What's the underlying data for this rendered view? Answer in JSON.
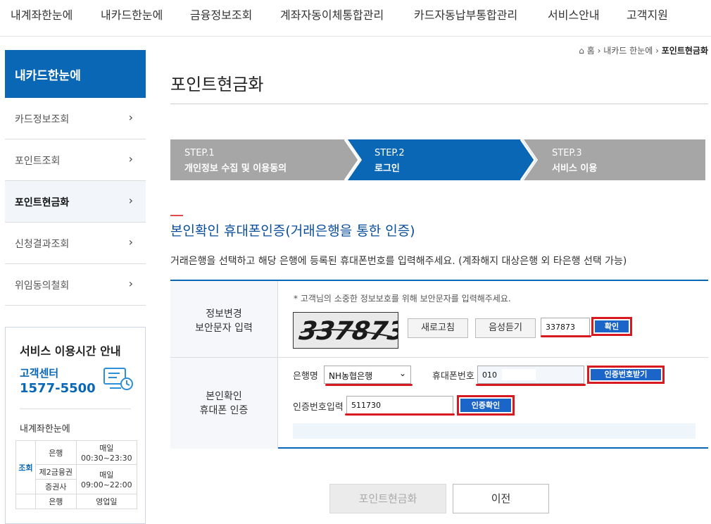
{
  "top_nav": [
    "내계좌한눈에",
    "내카드한눈에",
    "금융정보조회",
    "계좌자동이체통합관리",
    "카드자동납부통합관리",
    "서비스안내",
    "고객지원"
  ],
  "sidebar": {
    "title": "내카드한눈에",
    "items": [
      {
        "label": "카드정보조회"
      },
      {
        "label": "포인트조회"
      },
      {
        "label": "포인트현금화"
      },
      {
        "label": "신청결과조회"
      },
      {
        "label": "위임동의철회"
      }
    ],
    "active_index": 2
  },
  "service_box": {
    "title": "서비스 이용시간 안내",
    "center_label": "고객센터",
    "center_phone": "1577-5500",
    "subtitle": "내계좌한눈에",
    "table": {
      "category": "조회",
      "rows": [
        {
          "type": "은행",
          "time_label": "매일",
          "time": "00:30~23:30"
        },
        {
          "type": "제2금융권",
          "time_label": "매일",
          "time": "09:00~22:00"
        },
        {
          "type": "증권사",
          "time_label": "",
          "time": ""
        },
        {
          "type": "은행",
          "time_label": "영업일",
          "time": ""
        }
      ]
    }
  },
  "breadcrumb": {
    "home": "홈",
    "level1": "내카드 한눈에",
    "current": "포인트현금화"
  },
  "page_title": "포인트현금화",
  "steps": [
    {
      "num": "STEP.1",
      "label": "개인정보 수집 및 이용동의",
      "active": false
    },
    {
      "num": "STEP.2",
      "label": "로그인",
      "active": true
    },
    {
      "num": "STEP.3",
      "label": "서비스 이용",
      "active": false
    }
  ],
  "section": {
    "title": "본인확인 휴대폰인증(거래은행을 통한 인증)",
    "desc": "거래은행을 선택하고 해당 은행에 등록된 휴대폰번호를 입력해주세요. (계좌해지 대상은행 외 타은행 선택 가능)"
  },
  "captcha_row": {
    "label_l1": "정보변경",
    "label_l2": "보안문자 입력",
    "notice": "* 고객님의 소중한 정보보호를 위해 보안문자를 입력해주세요.",
    "captcha_text": "337873",
    "refresh_btn": "새로고침",
    "audio_btn": "음성듣기",
    "input_value": "337873",
    "confirm_btn": "확인"
  },
  "phone_row": {
    "label_l1": "본인확인",
    "label_l2": "휴대폰 인증",
    "bank_label": "은행명",
    "bank_value": "NH농협은행",
    "phone_label": "휴대폰번호",
    "phone_value": "010",
    "get_code_btn": "인증번호받기",
    "code_label": "인증번호입력",
    "code_value": "511730",
    "verify_btn": "인증확인"
  },
  "bottom_buttons": {
    "submit": "포인트현금화",
    "prev": "이전"
  },
  "colors": {
    "primary": "#0a67b5",
    "step_inactive": "#a6a6a6",
    "highlight": "#d71921"
  }
}
